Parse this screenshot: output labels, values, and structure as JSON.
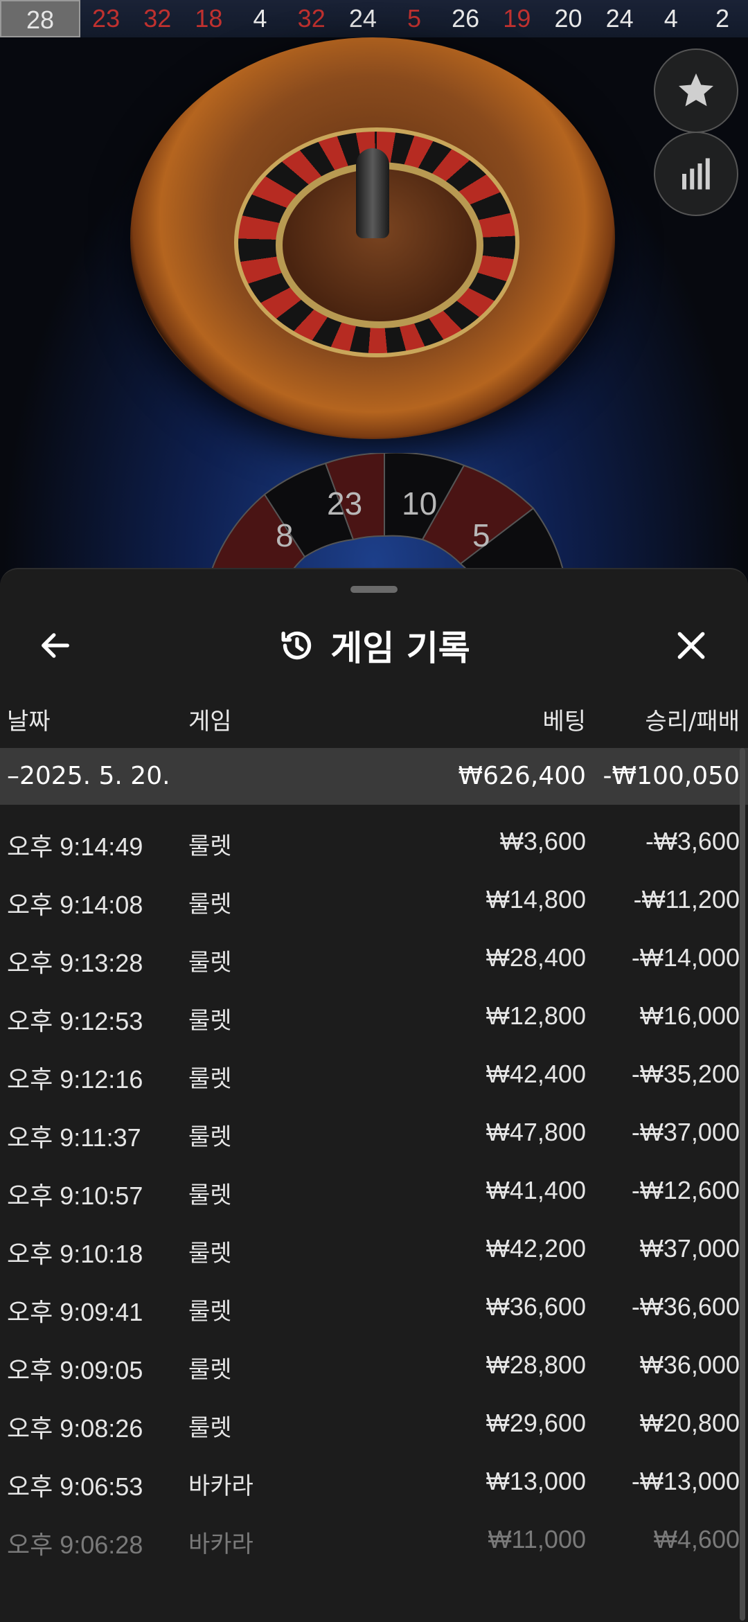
{
  "results_strip": [
    {
      "value": "28",
      "color": "gray"
    },
    {
      "value": "23",
      "color": "red"
    },
    {
      "value": "32",
      "color": "red"
    },
    {
      "value": "18",
      "color": "red"
    },
    {
      "value": "4",
      "color": "black"
    },
    {
      "value": "32",
      "color": "red"
    },
    {
      "value": "24",
      "color": "black"
    },
    {
      "value": "5",
      "color": "red"
    },
    {
      "value": "26",
      "color": "black"
    },
    {
      "value": "19",
      "color": "red"
    },
    {
      "value": "20",
      "color": "black"
    },
    {
      "value": "24",
      "color": "black"
    },
    {
      "value": "4",
      "color": "black"
    },
    {
      "value": "2",
      "color": "black"
    }
  ],
  "racetrack": {
    "labels": [
      "8",
      "23",
      "10",
      "5"
    ]
  },
  "sheet": {
    "title": "게임 기록",
    "icons": {
      "back": "arrow-left-icon",
      "history": "history-icon",
      "close": "close-icon",
      "favorite": "star-icon",
      "stats": "bar-chart-icon"
    },
    "columns": {
      "date": "날짜",
      "game": "게임",
      "bet": "베팅",
      "winloss": "승리/패배"
    },
    "summary": {
      "date": "–2025. 5. 20.",
      "bet": "₩626,400",
      "winloss": "-₩100,050"
    },
    "rows": [
      {
        "time": "오후 9:14:49",
        "game": "룰렛",
        "bet": "₩3,600",
        "winloss": "-₩3,600"
      },
      {
        "time": "오후 9:14:08",
        "game": "룰렛",
        "bet": "₩14,800",
        "winloss": "-₩11,200"
      },
      {
        "time": "오후 9:13:28",
        "game": "룰렛",
        "bet": "₩28,400",
        "winloss": "-₩14,000"
      },
      {
        "time": "오후 9:12:53",
        "game": "룰렛",
        "bet": "₩12,800",
        "winloss": "₩16,000"
      },
      {
        "time": "오후 9:12:16",
        "game": "룰렛",
        "bet": "₩42,400",
        "winloss": "-₩35,200"
      },
      {
        "time": "오후 9:11:37",
        "game": "룰렛",
        "bet": "₩47,800",
        "winloss": "-₩37,000"
      },
      {
        "time": "오후 9:10:57",
        "game": "룰렛",
        "bet": "₩41,400",
        "winloss": "-₩12,600"
      },
      {
        "time": "오후 9:10:18",
        "game": "룰렛",
        "bet": "₩42,200",
        "winloss": "₩37,000"
      },
      {
        "time": "오후 9:09:41",
        "game": "룰렛",
        "bet": "₩36,600",
        "winloss": "-₩36,600"
      },
      {
        "time": "오후 9:09:05",
        "game": "룰렛",
        "bet": "₩28,800",
        "winloss": "₩36,000"
      },
      {
        "time": "오후 9:08:26",
        "game": "룰렛",
        "bet": "₩29,600",
        "winloss": "₩20,800"
      },
      {
        "time": "오후 9:06:53",
        "game": "바카라",
        "bet": "₩13,000",
        "winloss": "-₩13,000"
      },
      {
        "time": "오후 9:06:28",
        "game": "바카라",
        "bet": "₩11,000",
        "winloss": "₩4,600"
      }
    ]
  }
}
